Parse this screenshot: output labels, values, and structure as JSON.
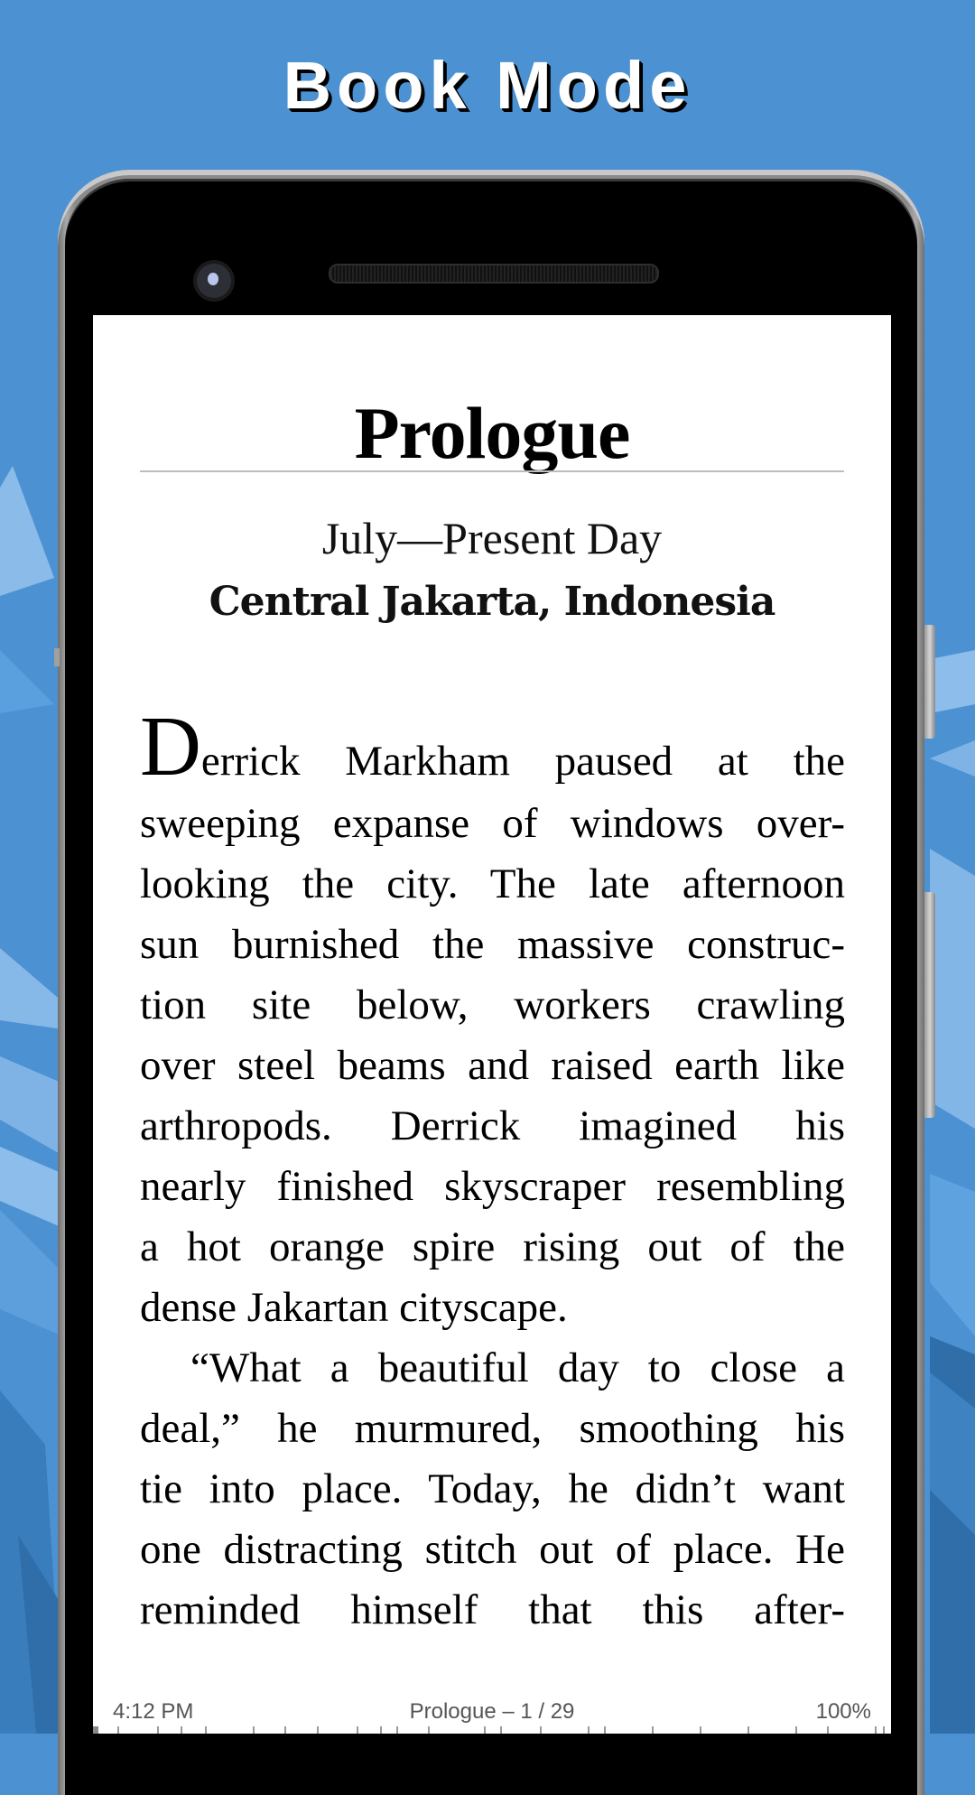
{
  "promo": {
    "title": "Book Mode"
  },
  "colors": {
    "background": "#4c92d2",
    "background_light": "#7fb6e8",
    "background_dark": "#2e6fae",
    "page": "#ffffff",
    "text": "#000000",
    "status_text": "#555555"
  },
  "reader": {
    "chapter_title": "Prologue",
    "date_line": "July—Present Day",
    "place_line": "Central Jakarta, Indonesia",
    "drop_cap": "D",
    "lines": [
      {
        "text": "errick Markham paused at the",
        "first": true
      },
      {
        "text": "sweeping expanse of windows over-"
      },
      {
        "text": "looking the city. The late afternoon"
      },
      {
        "text": "sun burnished the massive construc-"
      },
      {
        "text": "tion site below, workers crawling"
      },
      {
        "text": "over steel beams and raised earth like"
      },
      {
        "text": "arthropods. Derrick imagined his"
      },
      {
        "text": "nearly finished skyscraper resembling"
      },
      {
        "text": "a hot orange spire rising out of the"
      },
      {
        "text": "dense Jakartan cityscape.",
        "last": true
      },
      {
        "text": "“What a beautiful day to close a",
        "indent": true
      },
      {
        "text": "deal,” he murmured, smoothing his"
      },
      {
        "text": "tie into place. Today, he didn’t want"
      },
      {
        "text": "one distracting stitch out of place. He"
      },
      {
        "text": "reminded himself that this after-"
      }
    ]
  },
  "status_bar": {
    "time": "4:12 PM",
    "chapter_progress": "Prologue – 1 / 29",
    "percent": "100%",
    "book_progress_fraction": 0.005,
    "chapter_tick_fractions": [
      0.03,
      0.08,
      0.11,
      0.14,
      0.2,
      0.24,
      0.28,
      0.33,
      0.36,
      0.38,
      0.42,
      0.49,
      0.51,
      0.56,
      0.62,
      0.64,
      0.7,
      0.76,
      0.82,
      0.88,
      0.92,
      0.98,
      0.99
    ]
  }
}
